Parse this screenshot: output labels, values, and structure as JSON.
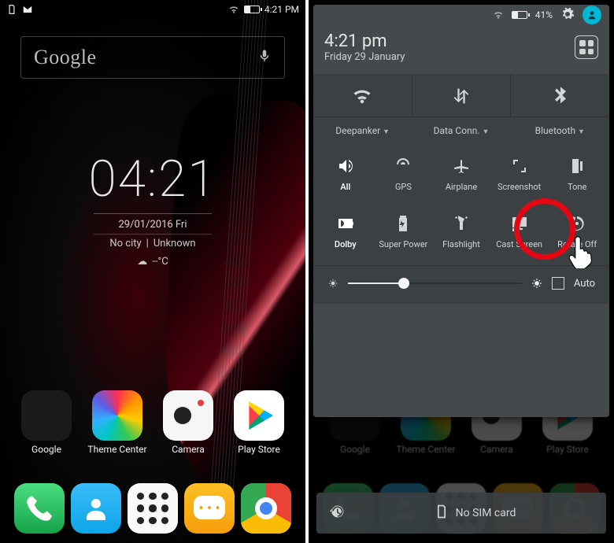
{
  "left": {
    "statusbar": {
      "time": "4:21 PM"
    },
    "search": {
      "brand": "Google"
    },
    "clock": {
      "time": "04:21",
      "date": "29/01/2016  Fri",
      "city": "No city",
      "loc": "Unknown",
      "temp": "--°C"
    },
    "apps": [
      {
        "label": "Google"
      },
      {
        "label": "Theme Center"
      },
      {
        "label": "Camera"
      },
      {
        "label": "Play Store"
      }
    ]
  },
  "right": {
    "status": {
      "battery": "41%"
    },
    "head": {
      "time": "4:21 pm",
      "date": "Friday 29 January"
    },
    "top": [
      {
        "label": "Deepanker"
      },
      {
        "label": "Data Conn."
      },
      {
        "label": "Bluetooth"
      }
    ],
    "tiles": [
      {
        "label": "All"
      },
      {
        "label": "GPS"
      },
      {
        "label": "Airplane"
      },
      {
        "label": "Screenshot"
      },
      {
        "label": "Tone"
      },
      {
        "label": "Dolby"
      },
      {
        "label": "Super Power"
      },
      {
        "label": "Flashlight"
      },
      {
        "label": "Cast Screen"
      },
      {
        "label": "Rotate Off"
      }
    ],
    "brightness": {
      "auto": "Auto"
    },
    "nosim": "No SIM card"
  }
}
